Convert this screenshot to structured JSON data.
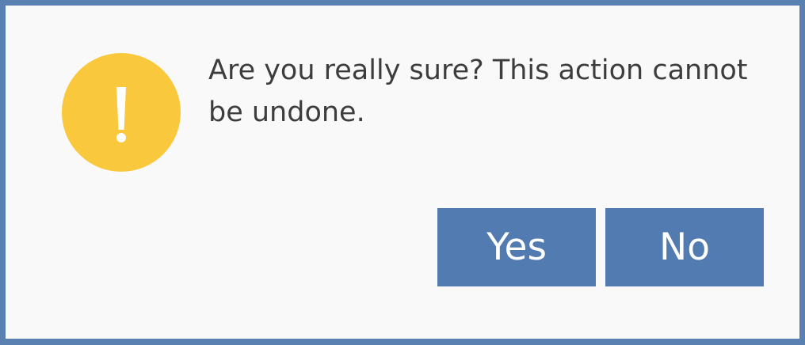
{
  "dialog": {
    "icon": "exclamation-warning-icon",
    "message": "Are you really sure? This action cannot be undone.",
    "buttons": {
      "yes_label": "Yes",
      "no_label": "No"
    }
  },
  "colors": {
    "frame": "#5a7fb1",
    "background": "#f9f9f9",
    "warning": "#f9c83c",
    "button": "#527cb1",
    "text": "#3d3d3d"
  }
}
